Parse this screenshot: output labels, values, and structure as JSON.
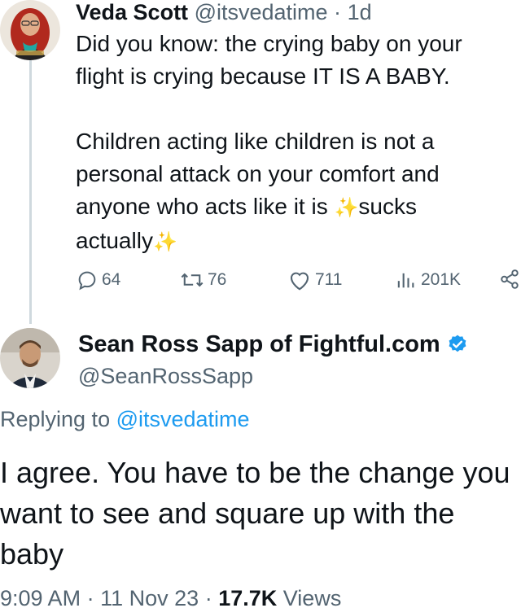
{
  "tweet1": {
    "display_name": "Veda Scott",
    "handle": "@itsvedatime",
    "separator": "·",
    "time": "1d",
    "text_line1": "Did you know: the crying baby on your",
    "text_line2": "flight is crying because IT IS A BABY.",
    "text_line3": "Children acting like children is not a",
    "text_line4": "personal attack on your comfort and",
    "text_line5a": "anyone who acts like it is ",
    "text_line5b": "sucks",
    "text_line6": "actually",
    "sparkle": "✨",
    "stats": {
      "replies": "64",
      "retweets": "76",
      "likes": "711",
      "views": "201K"
    },
    "icons": {
      "reply": "reply-icon",
      "retweet": "retweet-icon",
      "like": "heart-icon",
      "views": "views-icon",
      "share": "share-icon"
    }
  },
  "tweet2": {
    "display_name": "Sean Ross Sapp of Fightful.com",
    "handle": "@SeanRossSapp",
    "verified_color": "#1d9bf0",
    "replying_prefix": "Replying to ",
    "replying_to": "@itsvedatime",
    "text": "I agree. You have to be the change you want to see and square up with the baby",
    "time": "9:09 AM",
    "sep1": "·",
    "date": "11 Nov 23",
    "sep2": "·",
    "views_count": "17.7K",
    "views_label": "Views"
  },
  "colors": {
    "text": "#0f1419",
    "muted": "#536471",
    "accent": "#1d9bf0",
    "thread_line": "#cfd9de"
  }
}
